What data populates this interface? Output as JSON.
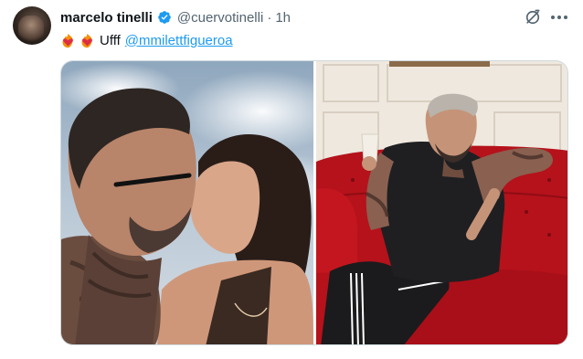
{
  "tweet": {
    "author": {
      "display_name": "marcelo tinelli",
      "handle": "@cuervotinelli",
      "verified": true,
      "avatar_icon": "profile-photo"
    },
    "separator": "·",
    "time": "1h",
    "text": {
      "emojis": [
        "heart-on-fire-emoji",
        "heart-on-fire-emoji"
      ],
      "word": "Ufff",
      "mention": "@mmilettfigueroa"
    },
    "actions": {
      "grok_icon": "grok-icon",
      "more_icon": "more-options-icon"
    },
    "media": {
      "count": 2,
      "photos": [
        {
          "name": "photo-kiss",
          "description_icon": "couple-kiss-photo"
        },
        {
          "name": "photo-sofa",
          "description_icon": "man-on-red-sofa-photo"
        }
      ]
    }
  },
  "colors": {
    "background": "#ffffff",
    "text_primary": "#0f1419",
    "text_secondary": "#536471",
    "link": "#1d9bf0",
    "verified_badge": "#1d9bf0",
    "sofa_red": "#b5121b"
  }
}
